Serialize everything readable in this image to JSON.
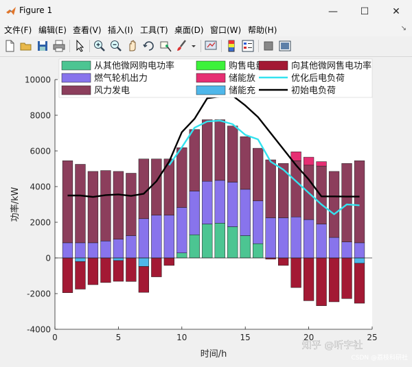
{
  "window": {
    "title": "Figure 1",
    "minimize_symbol": "—",
    "maximize_symbol": "☐",
    "close_symbol": "✕",
    "pin_symbol": "↘"
  },
  "menu": {
    "items": [
      "文件(F)",
      "编辑(E)",
      "查看(V)",
      "插入(I)",
      "工具(T)",
      "桌面(D)",
      "窗口(W)",
      "帮助(H)"
    ]
  },
  "toolbar": {
    "icons": [
      "new-figure-icon",
      "open-file-icon",
      "save-icon",
      "print-icon",
      "pointer-icon",
      "zoom-in-icon",
      "zoom-out-icon",
      "pan-icon",
      "rotate-3d-icon",
      "data-cursor-icon",
      "brush-icon",
      "link-plot-icon",
      "colorbar-icon",
      "legend-icon",
      "hide-plot-tools-icon",
      "show-plot-tools-icon"
    ]
  },
  "watermark": {
    "brand": "知乎 @听字社",
    "source": "CSDN @荔枝科研社"
  },
  "colors": {
    "buy_other": "#4cc592",
    "sell_grid": "#3cf23a",
    "sell_other": "#a31934",
    "gas": "#8874ec",
    "storage_discharge": "#e62e73",
    "opt_load": "#33e3ef",
    "wind": "#8c3e5c",
    "storage_charge": "#4fb7ea",
    "orig_load": "#000000"
  },
  "chart_data": {
    "type": "bar",
    "stacked": true,
    "x": [
      1,
      2,
      3,
      4,
      5,
      6,
      7,
      8,
      9,
      10,
      11,
      12,
      13,
      14,
      15,
      16,
      17,
      18,
      19,
      20,
      21,
      22,
      23,
      24
    ],
    "xlabel": "时间/h",
    "ylabel": "功率/kW",
    "xlim": [
      0,
      25
    ],
    "ylim": [
      -4000,
      10000
    ],
    "xticks": [
      0,
      5,
      10,
      15,
      20,
      25
    ],
    "yticks": [
      -4000,
      -2000,
      0,
      2000,
      4000,
      6000,
      8000,
      10000
    ],
    "grid": false,
    "legend_position": "top",
    "series": [
      {
        "name": "从其他微网购电功率",
        "key": "buy_other",
        "kind": "bar",
        "values": [
          0,
          0,
          0,
          0,
          0,
          0,
          0,
          0,
          0,
          280,
          1300,
          1900,
          1950,
          1750,
          1250,
          800,
          0,
          0,
          0,
          0,
          0,
          0,
          0,
          0
        ]
      },
      {
        "name": "燃气轮机出力",
        "key": "gas",
        "kind": "bar",
        "values": [
          850,
          850,
          850,
          950,
          1050,
          1250,
          2200,
          2400,
          2400,
          2550,
          2450,
          2400,
          2400,
          2500,
          2600,
          2400,
          2250,
          2250,
          2300,
          2150,
          1900,
          1150,
          900,
          850
        ]
      },
      {
        "name": "风力发电",
        "key": "wind",
        "kind": "bar",
        "values": [
          4600,
          4400,
          4000,
          3950,
          3800,
          3500,
          3350,
          3150,
          3150,
          3350,
          3450,
          3450,
          3400,
          3150,
          2950,
          2950,
          3250,
          3050,
          3150,
          3050,
          3250,
          3700,
          4400,
          4600
        ]
      },
      {
        "name": "购售电量",
        "key": "sell_grid",
        "kind": "bar",
        "values": [
          0,
          0,
          0,
          0,
          0,
          0,
          0,
          0,
          0,
          0,
          0,
          0,
          0,
          0,
          0,
          0,
          0,
          0,
          0,
          0,
          0,
          0,
          0,
          0
        ]
      },
      {
        "name": "储能放",
        "key": "storage_discharge",
        "kind": "bar",
        "values": [
          0,
          0,
          0,
          0,
          0,
          0,
          0,
          0,
          0,
          0,
          0,
          0,
          0,
          0,
          0,
          0,
          0,
          0,
          500,
          450,
          250,
          0,
          0,
          0
        ]
      },
      {
        "name": "储能充",
        "key": "storage_charge",
        "kind": "bar",
        "values": [
          0,
          -200,
          0,
          0,
          -150,
          0,
          -480,
          0,
          0,
          0,
          0,
          0,
          0,
          0,
          0,
          0,
          0,
          0,
          0,
          0,
          0,
          0,
          0,
          -300
        ]
      },
      {
        "name": "向其他微网售电功率",
        "key": "sell_other",
        "kind": "bar",
        "values": [
          -1950,
          -1550,
          -1500,
          -1380,
          -1160,
          -1320,
          -1450,
          -1060,
          -420,
          0,
          0,
          0,
          0,
          0,
          0,
          0,
          -70,
          -420,
          -1660,
          -2400,
          -2680,
          -2460,
          -2280,
          -2240
        ]
      },
      {
        "name": "优化后电负荷",
        "key": "opt_load",
        "kind": "line",
        "values": [
          null,
          null,
          null,
          null,
          null,
          null,
          null,
          null,
          5200,
          6200,
          7300,
          7650,
          7700,
          7500,
          6900,
          6650,
          5400,
          4950,
          4300,
          3650,
          3000,
          2450,
          3000,
          2950
        ]
      },
      {
        "name": "初始电负荷",
        "key": "orig_load",
        "kind": "line",
        "values": [
          3500,
          3500,
          3420,
          3520,
          3560,
          3480,
          3600,
          4300,
          5400,
          7050,
          7800,
          8950,
          9050,
          9100,
          8550,
          7900,
          7000,
          6100,
          5200,
          4400,
          3450,
          3450,
          3440,
          3440
        ]
      }
    ],
    "legend_order": [
      "buy_other",
      "sell_grid",
      "sell_other",
      "gas",
      "storage_discharge",
      "opt_load",
      "wind",
      "storage_charge",
      "orig_load"
    ]
  }
}
